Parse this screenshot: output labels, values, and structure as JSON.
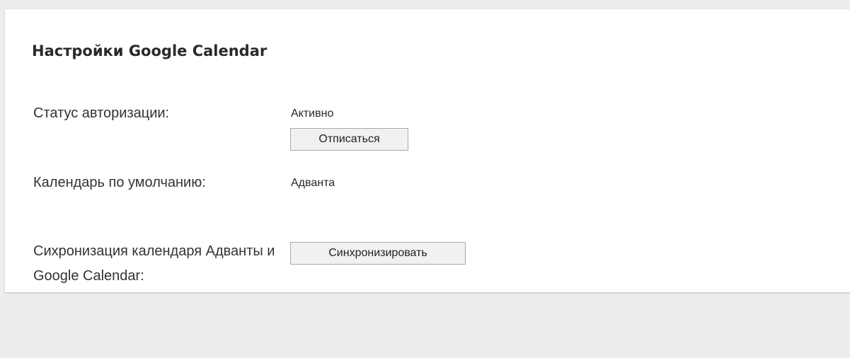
{
  "settings": {
    "title": "Настройки Google Calendar",
    "auth_status_label": "Статус авторизации:",
    "auth_status_value": "Активно",
    "unsubscribe_button": "Отписаться",
    "default_calendar_label": "Календарь по умолчанию:",
    "default_calendar_value": "Адванта",
    "sync_label": "Сихронизация календаря Адванты и Google Calendar:",
    "sync_button": "Синхронизировать"
  },
  "colors": {
    "page_background": "#ededed",
    "panel_background": "#ffffff",
    "button_background": "#f1f1f1",
    "button_border": "#a9a9a9"
  }
}
